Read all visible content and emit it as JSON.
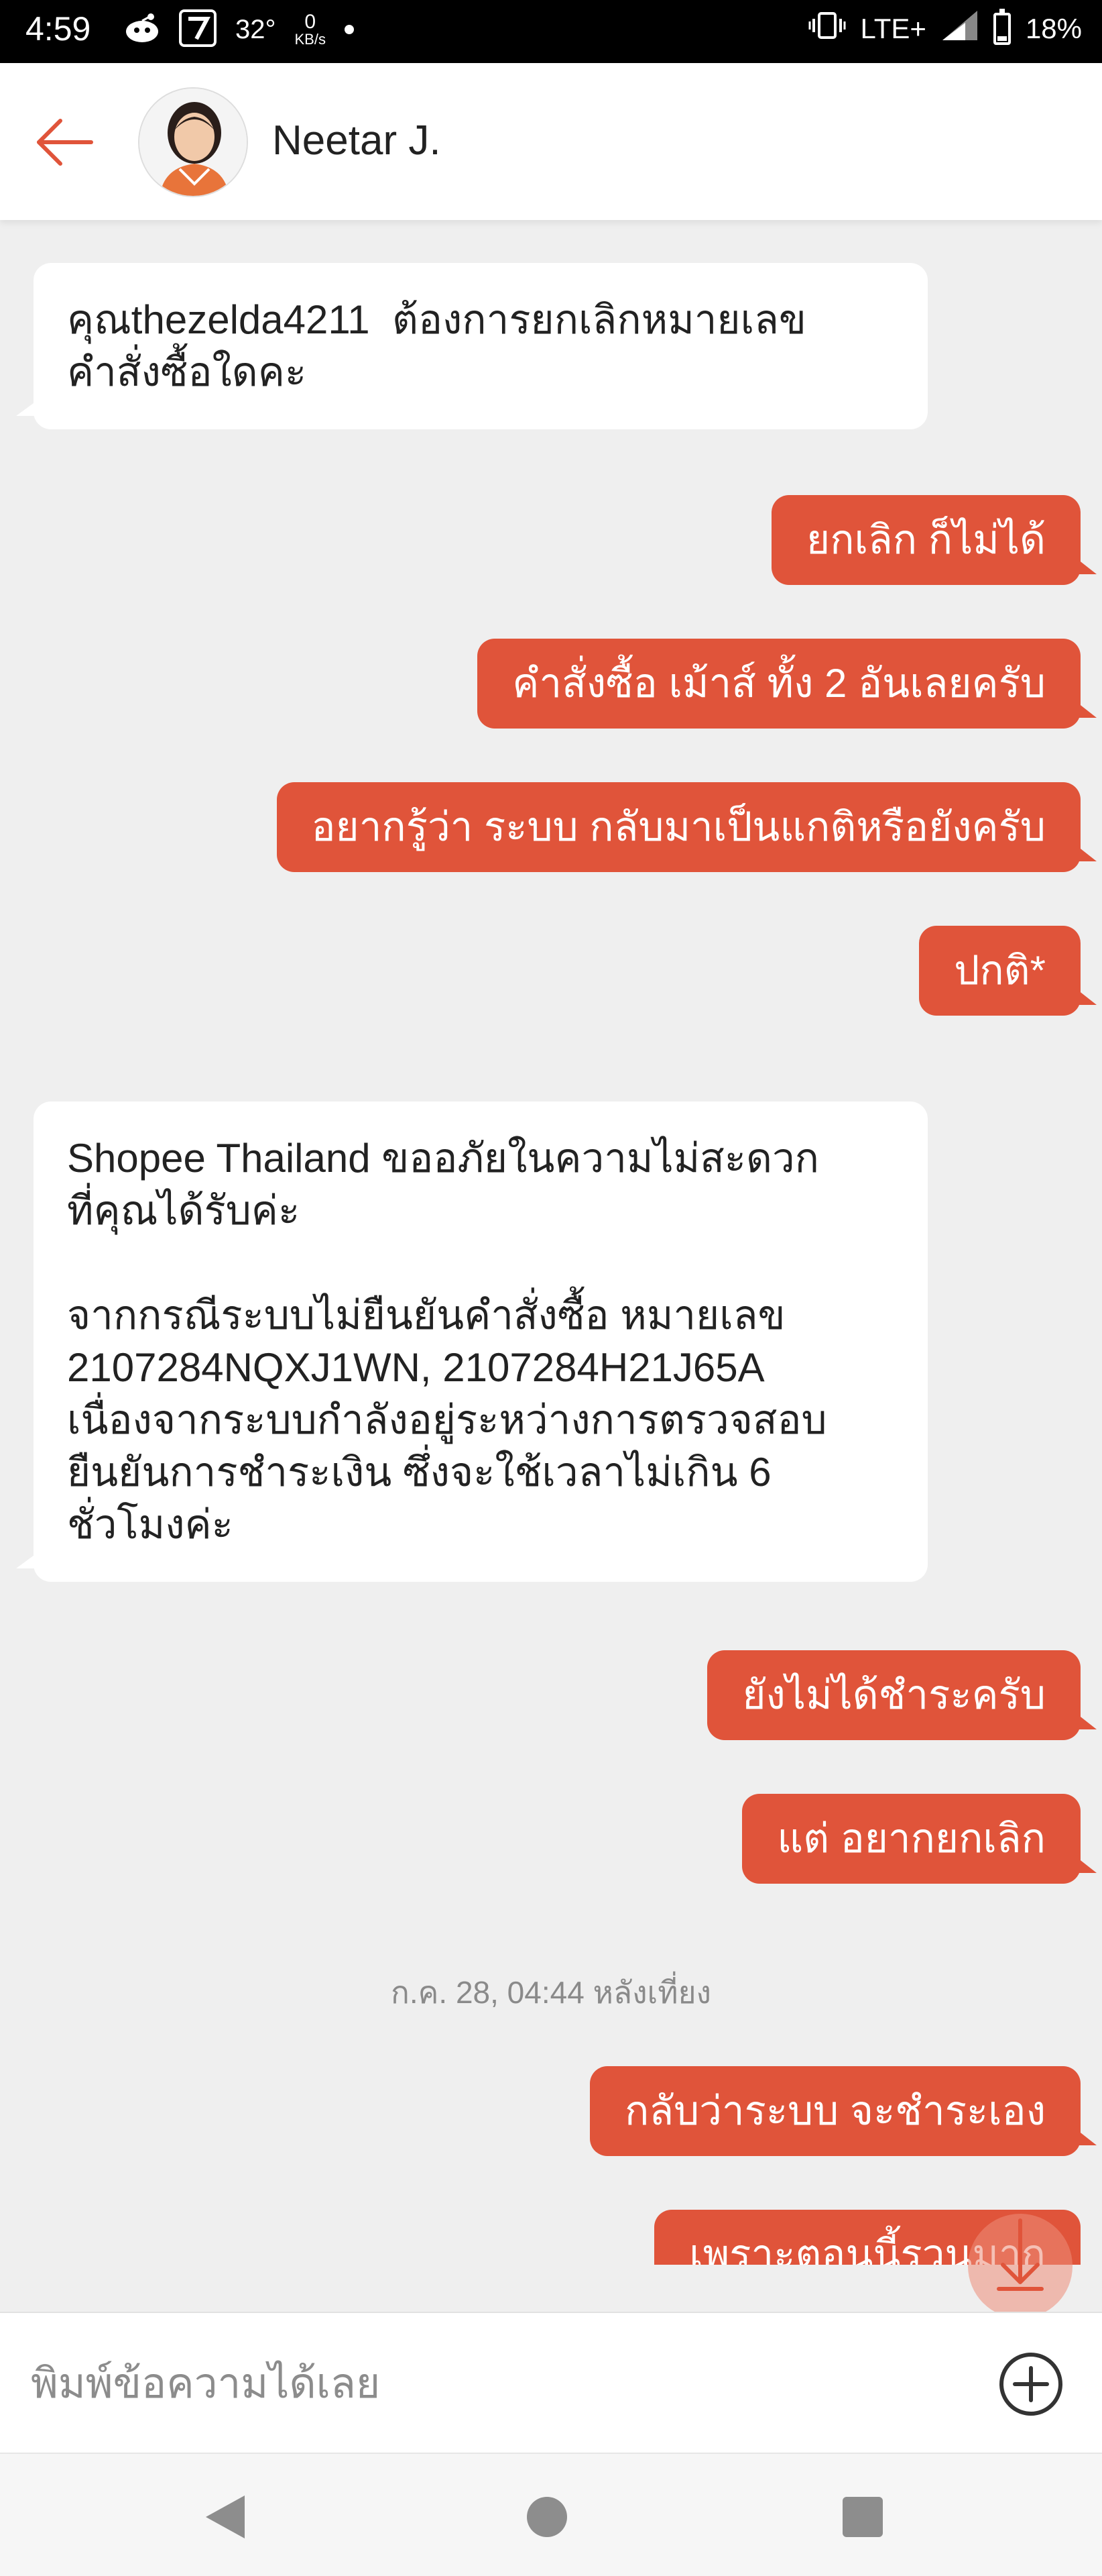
{
  "status_bar": {
    "time": "4:59",
    "temperature": "32°",
    "net_speed_value": "0",
    "net_speed_unit": "KB/s",
    "network": "LTE+",
    "battery": "18%",
    "battery_level": 0.18
  },
  "header": {
    "contact_name": "Neetar J."
  },
  "messages": [
    {
      "side": "in",
      "text": "คุณthezelda4211  ต้องการยกเลิกหมายเลข\nคำสั่งซื้อใดคะ"
    },
    {
      "side": "out",
      "text": "ยกเลิก ก็ไม่ได้"
    },
    {
      "side": "out",
      "text": "คำสั่งซื้อ เม้าส์ ทั้ง 2 อันเลยครับ"
    },
    {
      "side": "out",
      "text": "อยากรู้ว่า ระบบ กลับมาเป็นแกติหรือยังครับ"
    },
    {
      "side": "out",
      "text": "ปกติ*"
    },
    {
      "side": "in",
      "text": "Shopee Thailand ขออภัยในความไม่สะดวก\nที่คุณได้รับค่ะ\n\nจากกรณีระบบไม่ยืนยันคำสั่งซื้อ หมายเลข\n2107284NQXJ1WN, 2107284H21J65A\nเนื่องจากระบบกำลังอยู่ระหว่างการตรวจสอบ\nยืนยันการชำระเงิน ซึ่งจะใช้เวลาไม่เกิน 6\nชั่วโมงค่ะ"
    },
    {
      "side": "out",
      "text": "ยังไม่ได้ชำระครับ"
    },
    {
      "side": "out",
      "text": "แต่ อยากยกเลิก"
    },
    {
      "side": "out",
      "text": "กลับว่าระบบ จะชำระเอง"
    },
    {
      "side": "out",
      "text": "เพราะตอนนี้รวนมาก"
    }
  ],
  "timestamp": "ก.ค. 28, 04:44 หลังเที่ยง",
  "input": {
    "placeholder": "พิมพ์ข้อความได้เลย",
    "value": ""
  },
  "colors": {
    "accent": "#e0543a",
    "background": "#efefef",
    "incoming_bubble": "#ffffff"
  },
  "icons": {
    "back": "arrow-left-icon",
    "add": "plus-circle-icon",
    "scroll_down": "arrow-down-icon",
    "nav_back": "triangle-back-icon",
    "nav_home": "circle-home-icon",
    "nav_recent": "square-recents-icon"
  }
}
